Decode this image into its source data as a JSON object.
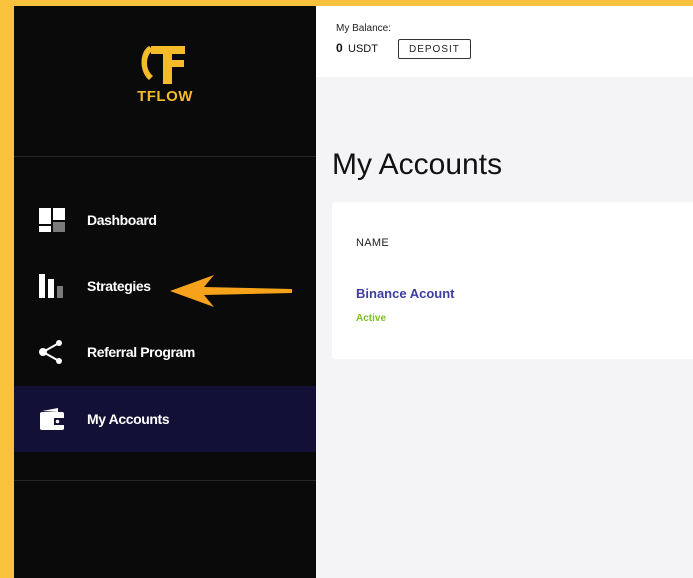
{
  "brand": {
    "name": "TFLOW",
    "color": "#f5bb28"
  },
  "sidebar": {
    "items": [
      {
        "label": "Dashboard",
        "icon": "dashboard-icon"
      },
      {
        "label": "Strategies",
        "icon": "bar-chart-icon"
      },
      {
        "label": "Referral Program",
        "icon": "share-icon"
      },
      {
        "label": "My Accounts",
        "icon": "wallet-icon",
        "active": true
      }
    ]
  },
  "header": {
    "balance_label": "My Balance:",
    "balance_amount": "0",
    "balance_unit": "USDT",
    "deposit_label": "DEPOSIT"
  },
  "main": {
    "title": "My Accounts",
    "table": {
      "column": "NAME",
      "rows": [
        {
          "name": "Binance Acount",
          "status": "Active"
        }
      ]
    }
  },
  "colors": {
    "sidebar_bg": "#0a0a0a",
    "active_bg": "#121036",
    "accent_orange": "#f7a21b",
    "link": "#3d3e9e",
    "status_active": "#7ac124"
  }
}
